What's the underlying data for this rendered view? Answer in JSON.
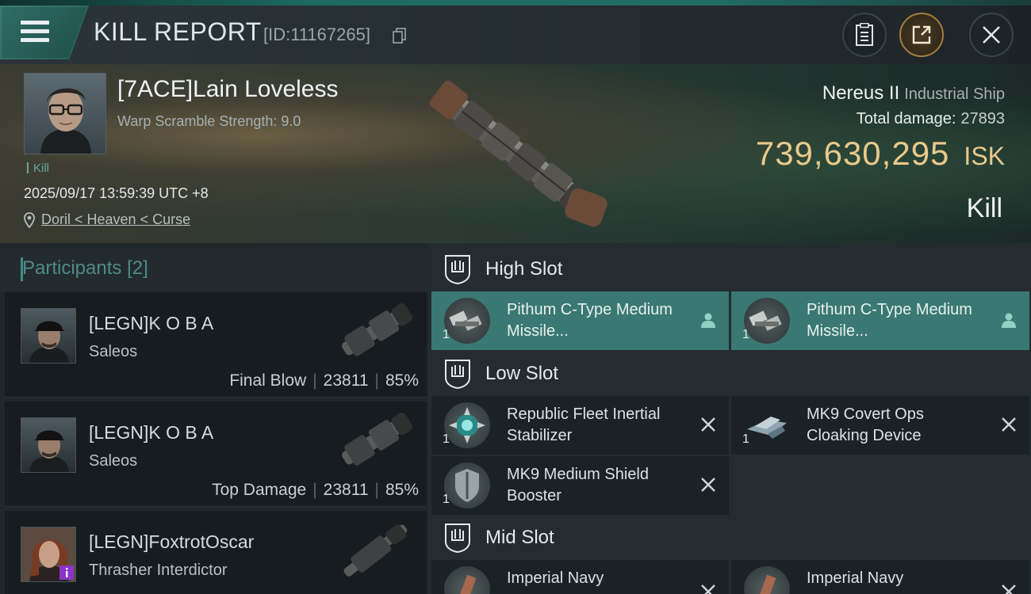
{
  "header": {
    "title": "KILL REPORT",
    "report_id": "[ID:11167265]"
  },
  "victim": {
    "name": "[7ACE]Lain Loveless",
    "warp_scramble": "Warp Scramble Strength: 9.0",
    "tag": "Kill",
    "datetime": "2025/09/17 13:59:39 UTC +8",
    "location": "Doril < Heaven < Curse",
    "ship_name": "Nereus II",
    "ship_class": "Industrial Ship",
    "total_damage_label": "Total damage:",
    "total_damage": "27893",
    "isk_value": "739,630,295",
    "isk_unit": "ISK",
    "result": "Kill"
  },
  "participants": {
    "label": "Participants",
    "count": "[2]",
    "items": [
      {
        "name": "[LEGN]K O B A",
        "ship": "Saleos",
        "role": "Final Blow",
        "damage": "23811",
        "percent": "85%"
      },
      {
        "name": "[LEGN]K O B A",
        "ship": "Saleos",
        "role": "Top Damage",
        "damage": "23811",
        "percent": "85%"
      },
      {
        "name": "[LEGN]FoxtrotOscar",
        "ship": "Thrasher Interdictor"
      }
    ]
  },
  "slots": {
    "high": {
      "label": "High Slot",
      "modules": [
        {
          "name": "Pithum C-Type Medium Missile...",
          "qty": "1"
        },
        {
          "name": "Pithum C-Type Medium Missile...",
          "qty": "1"
        }
      ]
    },
    "low": {
      "label": "Low Slot",
      "modules": [
        {
          "name": "Republic Fleet Inertial Stabilizer",
          "qty": "1"
        },
        {
          "name": "MK9 Covert Ops Cloaking Device",
          "qty": "1"
        },
        {
          "name": "MK9 Medium Shield Booster",
          "qty": "1"
        }
      ]
    },
    "mid": {
      "label": "Mid Slot",
      "modules": [
        {
          "name": "Imperial Navy"
        },
        {
          "name": "Imperial Navy"
        }
      ]
    }
  },
  "colors": {
    "accent": "#3a7873",
    "isk": "#e9c98a"
  }
}
